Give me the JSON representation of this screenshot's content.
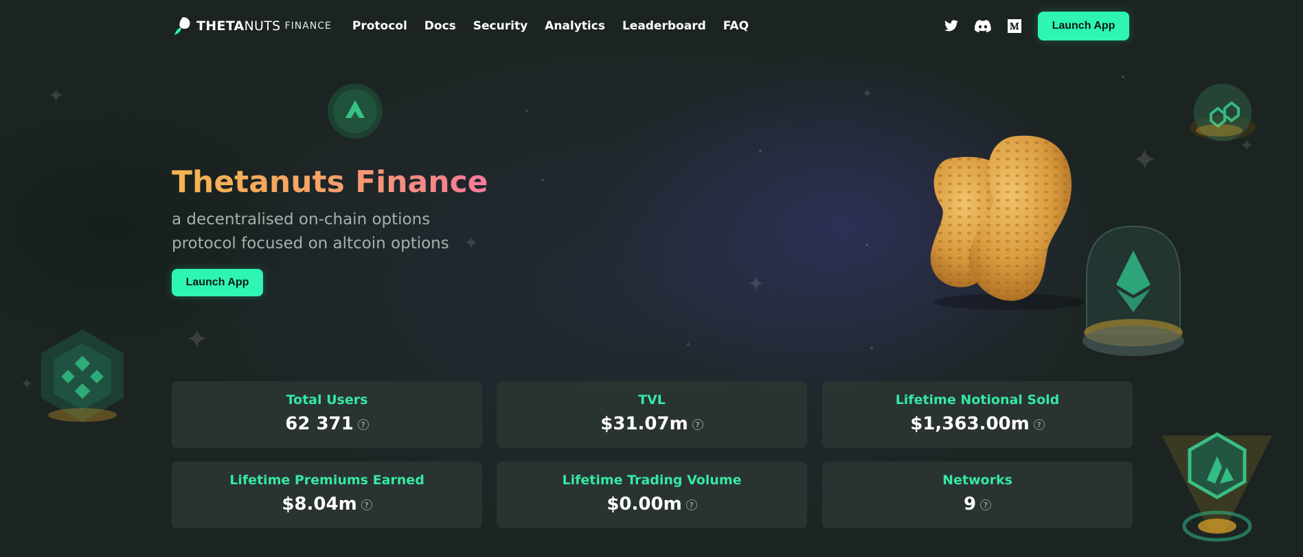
{
  "nav": {
    "logo_bold": "THETA",
    "logo_light": "NUTS",
    "logo_sub": "FINANCE",
    "links": [
      "Protocol",
      "Docs",
      "Security",
      "Analytics",
      "Leaderboard",
      "FAQ"
    ],
    "social_icons": [
      "twitter-icon",
      "discord-icon",
      "medium-icon"
    ],
    "launch_label": "Launch App"
  },
  "hero": {
    "title": "Thetanuts Finance",
    "subtitle": "a decentralised on-chain options protocol focused on altcoin options",
    "launch_label": "Launch App"
  },
  "stats": [
    {
      "label": "Total Users",
      "value": "62 371"
    },
    {
      "label": "TVL",
      "value": "$31.07m"
    },
    {
      "label": "Lifetime Notional Sold",
      "value": "$1,363.00m"
    },
    {
      "label": "Lifetime Premiums Earned",
      "value": "$8.04m"
    },
    {
      "label": "Lifetime Trading Volume",
      "value": "$0.00m"
    },
    {
      "label": "Networks",
      "value": "9"
    }
  ],
  "help_glyph": "?",
  "colors": {
    "accent": "#2ef5b4",
    "stat_label": "#35e8a3",
    "title_gradient_start": "#f3b64e",
    "title_gradient_end": "#f57a9a",
    "background": "#1c2422",
    "card": "#2c3634"
  },
  "decorations": [
    "avalanche-coin-icon",
    "polygon-coin-icon",
    "binance-coin-icon",
    "ethereum-dome-icon",
    "arbitrum-logo-icon",
    "peanut-illustration"
  ]
}
